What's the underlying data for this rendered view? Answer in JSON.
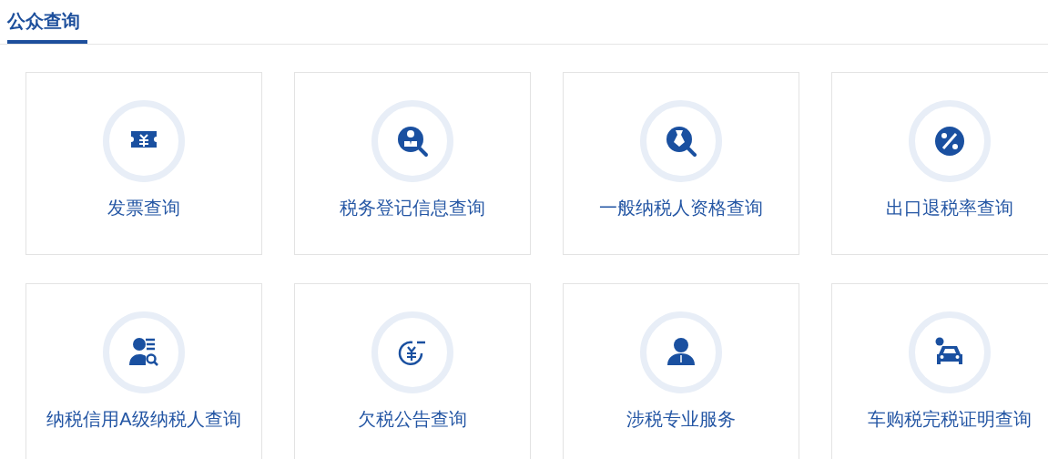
{
  "section": {
    "title": "公众查询",
    "selected": true
  },
  "tiles": [
    {
      "label": "发票查询"
    },
    {
      "label": "税务登记信息查询"
    },
    {
      "label": "一般纳税人资格查询"
    },
    {
      "label": "出口退税率查询"
    },
    {
      "label": "纳税信用A级纳税人查询"
    },
    {
      "label": "欠税公告查询"
    },
    {
      "label": "涉税专业服务"
    },
    {
      "label": "车购税完税证明查询"
    }
  ]
}
